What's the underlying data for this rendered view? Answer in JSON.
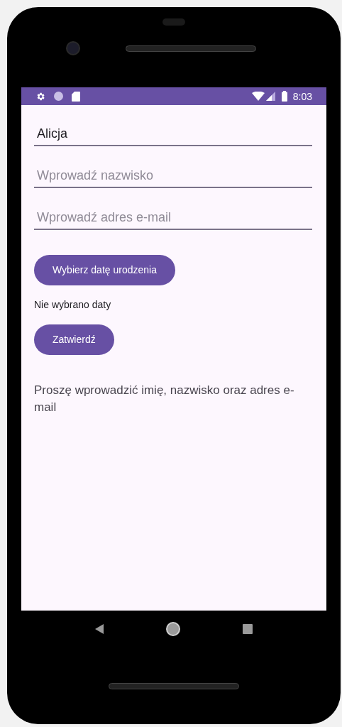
{
  "status_bar": {
    "time": "8:03"
  },
  "fields": [
    {
      "value": "Alicja"
    },
    {
      "placeholder": "Wprowadź nazwisko"
    },
    {
      "placeholder": "Wprowadź adres e-mail"
    }
  ],
  "date_button": "Wybierz datę urodzenia",
  "date_text": "Nie wybrano daty",
  "submit_button": "Zatwierdź",
  "message": "Proszę wprowadzić imię, nazwisko oraz adres e-mail"
}
